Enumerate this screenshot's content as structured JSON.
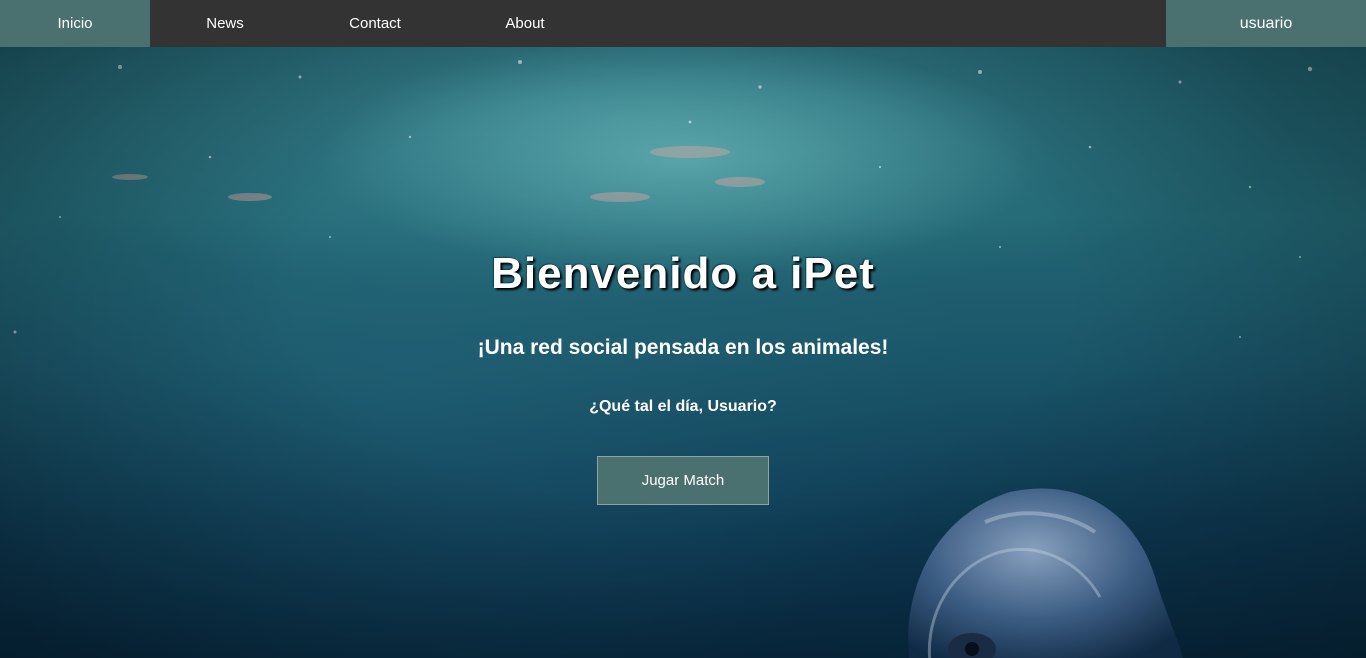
{
  "navbar": {
    "items": [
      {
        "label": "Inicio",
        "active": true
      },
      {
        "label": "News",
        "active": false
      },
      {
        "label": "Contact",
        "active": false
      },
      {
        "label": "About",
        "active": false
      }
    ],
    "user_label": "usuario"
  },
  "hero": {
    "title": "Bienvenido a iPet",
    "subtitle": "¡Una red social pensada en los animales!",
    "greeting": "¿Qué tal el día, Usuario?",
    "button_label": "Jugar Match"
  },
  "colors": {
    "navbar_bg": "#333333",
    "accent": "#4a7070",
    "text": "#ffffff"
  },
  "icons": {
    "background": "underwater-dolphin-image"
  }
}
